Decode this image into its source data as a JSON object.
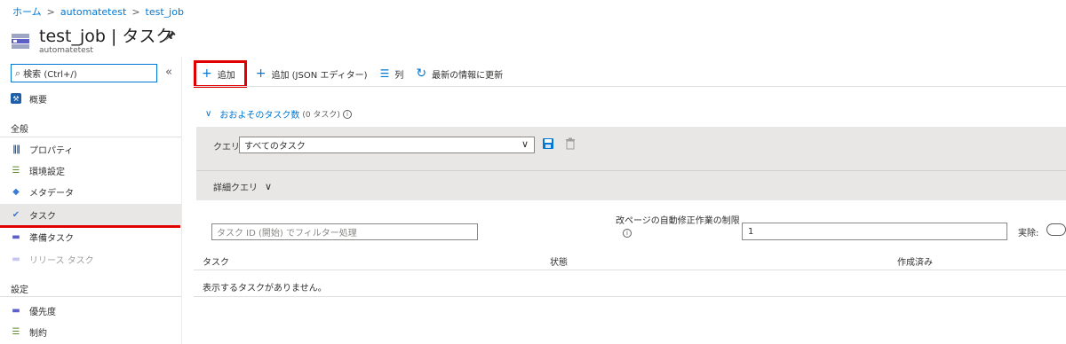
{
  "breadcrumb": {
    "home": "ホーム",
    "sep": ">",
    "account": "automatetest",
    "job": "test_job"
  },
  "header": {
    "title": "test_job | タスク",
    "subtitle": "automatetest"
  },
  "sidebar": {
    "search_placeholder": "検索 (Ctrl+/)",
    "collapse": "«",
    "overview": "概要",
    "section_general": "全般",
    "items_general": [
      {
        "label": "プロパティ",
        "icon": "properties-icon"
      },
      {
        "label": "環境設定",
        "icon": "environment-icon"
      },
      {
        "label": "メタデータ",
        "icon": "metadata-icon"
      },
      {
        "label": "タスク",
        "icon": "tasks-icon",
        "active": true
      },
      {
        "label": "準備タスク",
        "icon": "prep-task-icon"
      },
      {
        "label": "リリース タスク",
        "icon": "release-task-icon",
        "disabled": true
      }
    ],
    "section_settings": "設定",
    "items_settings": [
      {
        "label": "優先度",
        "icon": "priority-icon"
      },
      {
        "label": "制約",
        "icon": "constraints-icon"
      }
    ]
  },
  "toolbar": {
    "add": "追加",
    "add_json": "追加 (JSON エディター)",
    "columns": "列",
    "refresh": "最新の情報に更新"
  },
  "content": {
    "approx_label": "おおよそのタスク数",
    "approx_count": "(0 タスク)",
    "query_label": "クエリ:",
    "query_value": "すべてのタスク",
    "advanced_query": "詳細クエリ",
    "filter_placeholder": "タスク ID (開始) でフィルター処理",
    "limit_label": "改ページの自動修正作業の制限",
    "limit_value": "1",
    "exec_label": "実除:",
    "columns": [
      "タスク",
      "状態",
      "作成済み"
    ],
    "empty_message": "表示するタスクがありません。"
  },
  "colors": {
    "accent": "#0078d4",
    "highlight": "#e00000",
    "panel": "#e9e7e6"
  }
}
